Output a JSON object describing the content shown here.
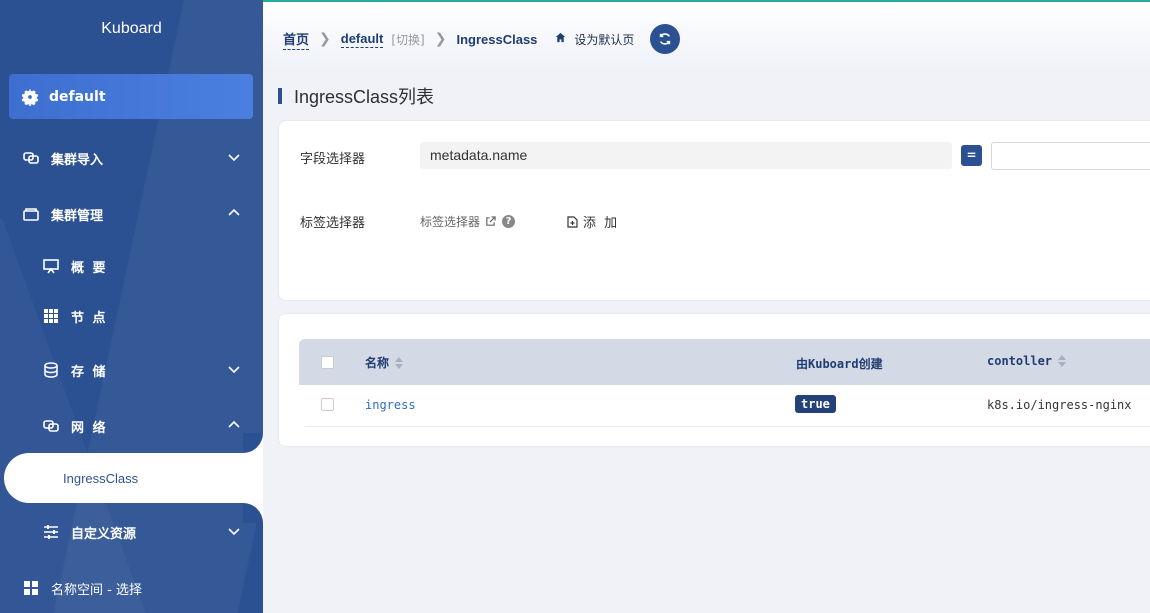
{
  "sidebar": {
    "brand": "Kuboard",
    "cluster": "default",
    "items": [
      {
        "label": "集群导入",
        "icon": "cluster-import-icon"
      },
      {
        "label": "集群管理",
        "icon": "cluster-manage-icon"
      },
      {
        "label": "概 要",
        "icon": "overview-icon"
      },
      {
        "label": "节 点",
        "icon": "nodes-icon"
      },
      {
        "label": "存 储",
        "icon": "storage-icon"
      },
      {
        "label": "网 络",
        "icon": "network-icon"
      },
      {
        "label": "IngressClass",
        "icon": ""
      },
      {
        "label": "自定义资源",
        "icon": "custom-resource-icon"
      },
      {
        "label": "名称空间 - 选择",
        "icon": "namespace-icon"
      }
    ]
  },
  "breadcrumb": {
    "home": "首页",
    "cluster": "default",
    "switch": "[切换]",
    "current": "IngressClass",
    "set_default": "设为默认页"
  },
  "page": {
    "title": "IngressClass列表"
  },
  "filter": {
    "field_selector_label": "字段选择器",
    "field_selector_value": "metadata.name",
    "operator": "=",
    "value_placeholder": "",
    "label_selector_label": "标签选择器",
    "label_selector_link": "标签选择器",
    "help": "?",
    "add_label": "添 加"
  },
  "table": {
    "columns": [
      "名称",
      "由Kuboard创建",
      "contoller"
    ],
    "rows": [
      {
        "name": "ingress",
        "created_by_kuboard": "true",
        "controller": "k8s.io/ingress-nginx"
      }
    ]
  },
  "colors": {
    "sidebar": "#2b5192",
    "accent": "#23b09a",
    "tag": "#23427a"
  }
}
